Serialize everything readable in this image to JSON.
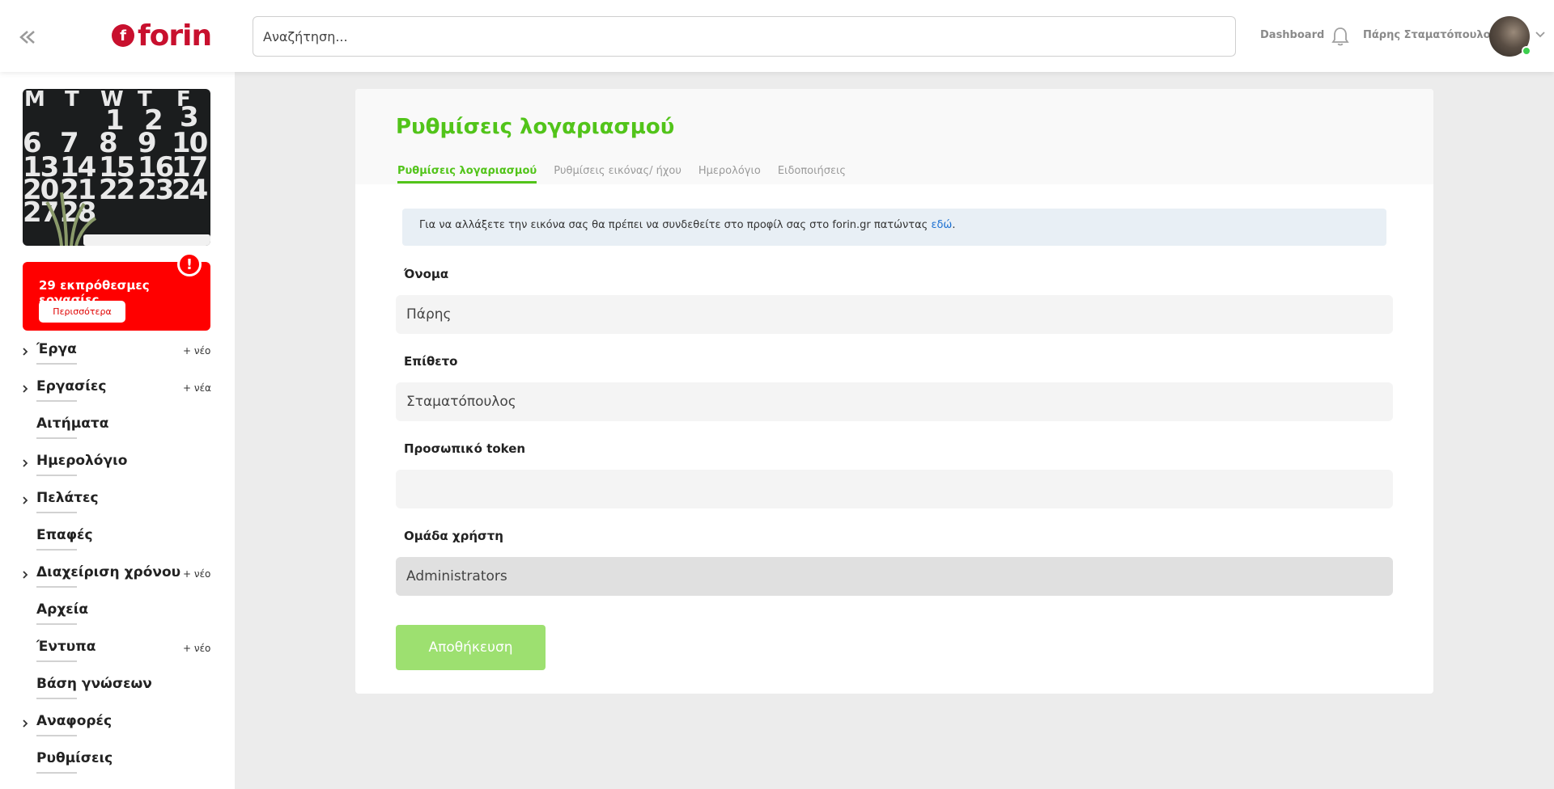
{
  "header": {
    "logo_text": "forin",
    "search_placeholder": "Αναζήτηση...",
    "dashboard_label": "Dashboard",
    "user_name": "Πάρης Σταματόπουλος"
  },
  "sidebar": {
    "calendar_days_row": [
      "M",
      "T",
      "W",
      "T",
      "F"
    ],
    "alert": {
      "text": "29 εκπρόθεσμες εργασίες",
      "more_label": "Περισσότερα",
      "badge": "!"
    },
    "items": [
      {
        "label": "Έργα",
        "new": "+ νέο",
        "expandable": true
      },
      {
        "label": "Εργασίες",
        "new": "+ νέα",
        "expandable": true
      },
      {
        "label": "Αιτήματα",
        "new": "",
        "expandable": false
      },
      {
        "label": "Ημερολόγιο",
        "new": "",
        "expandable": true
      },
      {
        "label": "Πελάτες",
        "new": "",
        "expandable": true
      },
      {
        "label": "Επαφές",
        "new": "",
        "expandable": false
      },
      {
        "label": "Διαχείριση χρόνου",
        "new": "+ νέο",
        "expandable": true
      },
      {
        "label": "Αρχεία",
        "new": "",
        "expandable": false
      },
      {
        "label": "Έντυπα",
        "new": "+ νέο",
        "expandable": false
      },
      {
        "label": "Βάση γνώσεων",
        "new": "",
        "expandable": false
      },
      {
        "label": "Αναφορές",
        "new": "",
        "expandable": true
      },
      {
        "label": "Ρυθμίσεις",
        "new": "",
        "expandable": false
      }
    ]
  },
  "main": {
    "title": "Ρυθμίσεις λογαριασμού",
    "tabs": [
      {
        "label": "Ρυθμίσεις λογαριασμού",
        "active": true
      },
      {
        "label": "Ρυθμίσεις εικόνας/ ήχου",
        "active": false
      },
      {
        "label": "Ημερολόγιο",
        "active": false
      },
      {
        "label": "Ειδοποιήσεις",
        "active": false
      }
    ],
    "info_text": "Για να αλλάξετε την εικόνα σας θα πρέπει να συνδεθείτε στο προφίλ σας στο forin.gr πατώντας ",
    "info_link": "εδώ",
    "info_suffix": ".",
    "fields": {
      "first_name_label": "Όνομα",
      "first_name_value": "Πάρης",
      "last_name_label": "Επίθετο",
      "last_name_value": "Σταματόπουλος",
      "token_label": "Προσωπικό token",
      "token_value": "",
      "group_label": "Ομάδα χρήστη",
      "group_value": "Administrators"
    },
    "save_label": "Αποθήκευση"
  },
  "colors": {
    "accent": "#52c41a",
    "brand": "#c8102e",
    "alert": "#ff0000",
    "save_button": "#9de070"
  }
}
